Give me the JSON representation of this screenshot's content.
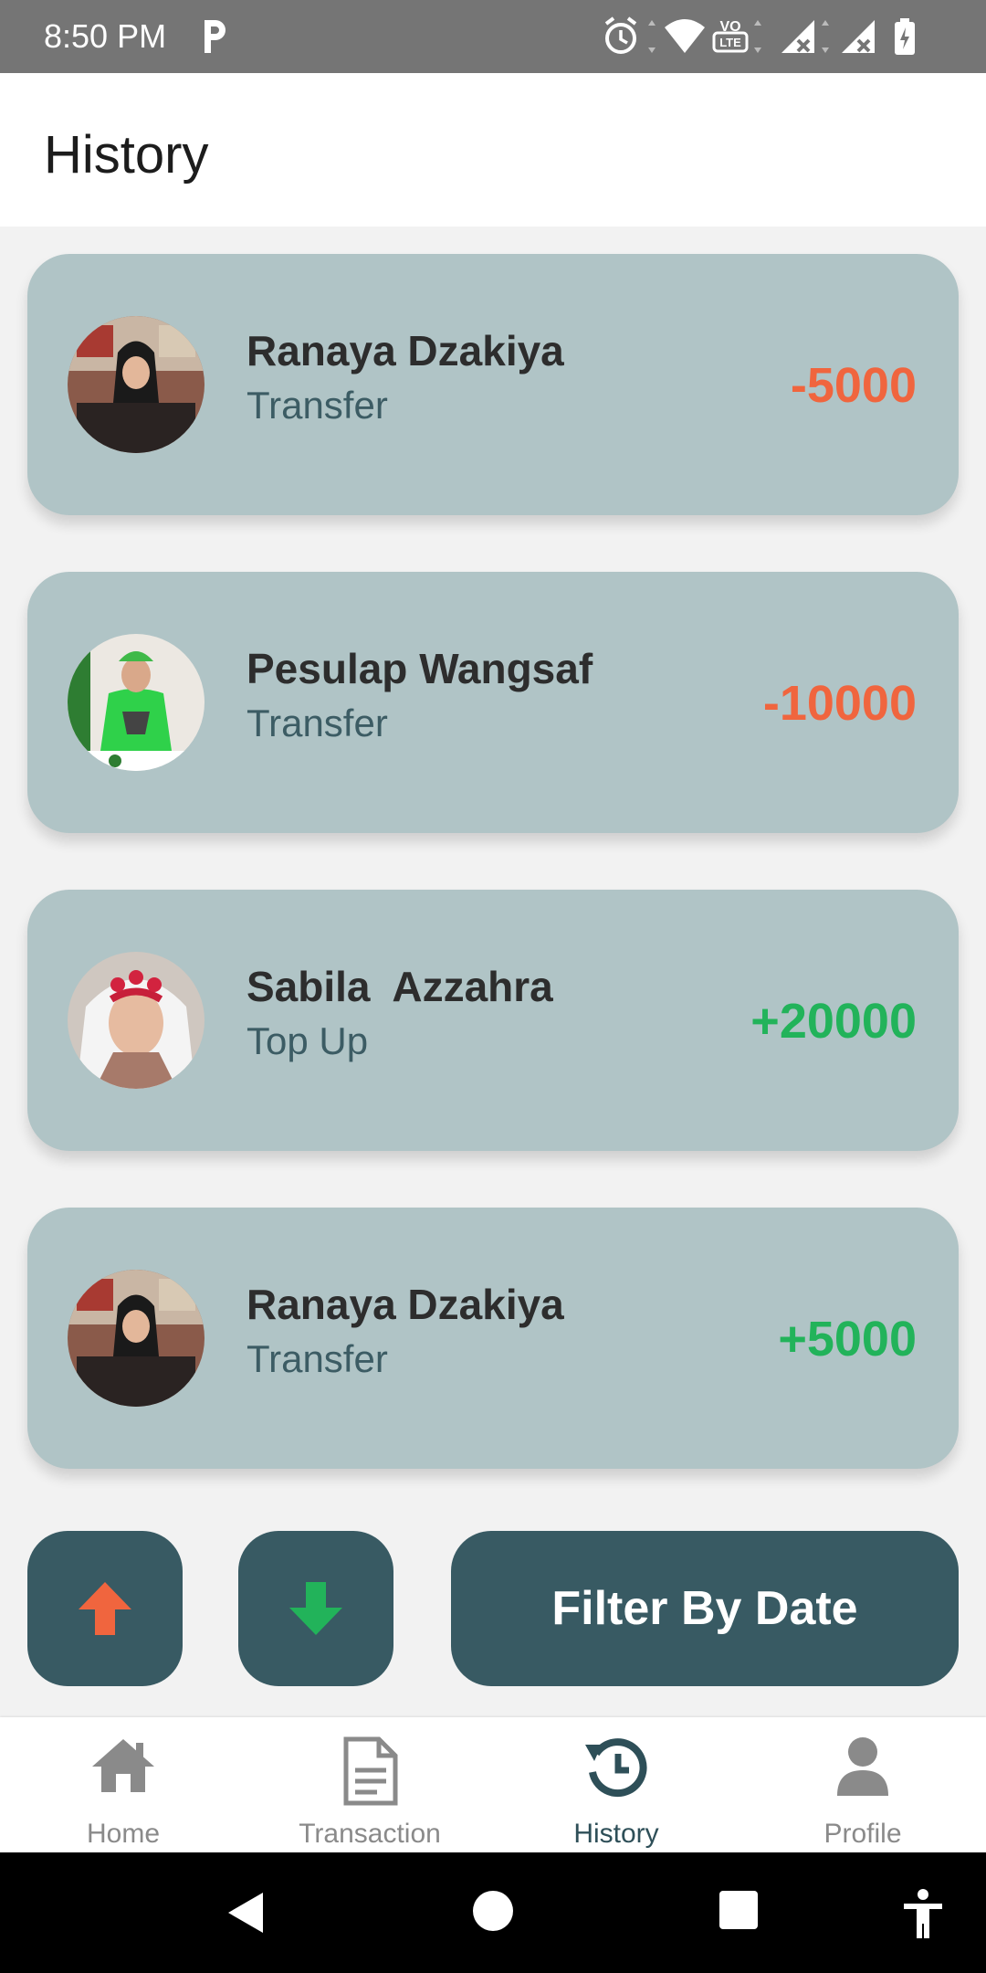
{
  "status_bar": {
    "time": "8:50 PM",
    "icons": [
      "parking-app-icon",
      "alarm-icon",
      "wifi-icon",
      "volte-icon",
      "signal-icon",
      "signal-icon",
      "battery-icon"
    ]
  },
  "header": {
    "title": "History"
  },
  "transactions": [
    {
      "name": "Ranaya Dzakiya",
      "type": "Transfer",
      "amount": "-5000",
      "amount_color": "#f0653e"
    },
    {
      "name": "Pesulap Wangsaf",
      "type": "Transfer",
      "amount": "-10000",
      "amount_color": "#f0653e"
    },
    {
      "name": "Sabila  Azzahra",
      "type": "Top Up",
      "amount": "+20000",
      "amount_color": "#22b35a"
    },
    {
      "name": "Ranaya Dzakiya",
      "type": "Transfer",
      "amount": "+5000",
      "amount_color": "#22b35a"
    }
  ],
  "actions": {
    "sort_up_icon": "arrow-up-icon",
    "sort_down_icon": "arrow-down-icon",
    "filter_label": "Filter By Date"
  },
  "bottom_nav": {
    "items": [
      {
        "label": "Home",
        "icon": "home-icon"
      },
      {
        "label": "Transaction",
        "icon": "document-icon"
      },
      {
        "label": "History",
        "icon": "history-icon",
        "active": true
      },
      {
        "label": "Profile",
        "icon": "person-icon"
      }
    ]
  },
  "colors": {
    "card_bg": "#b0c4c6",
    "button_bg": "#385a63",
    "negative": "#f0653e",
    "positive": "#22b35a"
  }
}
